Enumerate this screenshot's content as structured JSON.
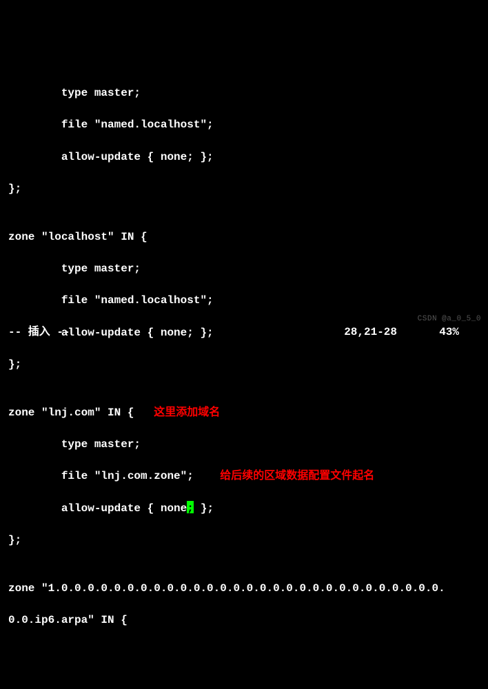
{
  "code": {
    "l1": "        type master;",
    "l2": "        file \"named.localhost\";",
    "l3": "        allow-update { none; };",
    "l4": "};",
    "l5": "",
    "l6": "zone \"localhost\" IN {",
    "l7": "        type master;",
    "l8": "        file \"named.localhost\";",
    "l9": "        allow-update { none; };",
    "l10": "};",
    "l11": "",
    "l12a": "zone \"lnj.com\" IN {",
    "l13": "        type master;",
    "l14a": "        file \"lnj.com.zone\";",
    "l15a": "        allow-update { none",
    "l15b": " };",
    "l16": "};",
    "l17": "",
    "l18": "zone \"1.0.0.0.0.0.0.0.0.0.0.0.0.0.0.0.0.0.0.0.0.0.0.0.0.0.0.0.0.0.",
    "l19": "0.0.ip6.arpa\" IN {"
  },
  "annotations": {
    "domain_hint": "这里添加域名",
    "file_hint": "给后续的区域数据配置文件起名"
  },
  "cursor_char": ";",
  "status": {
    "mode": "-- 插入 --",
    "position": "28,21-28",
    "percent": "43%"
  },
  "watermark": "CSDN @a_0_5_0"
}
